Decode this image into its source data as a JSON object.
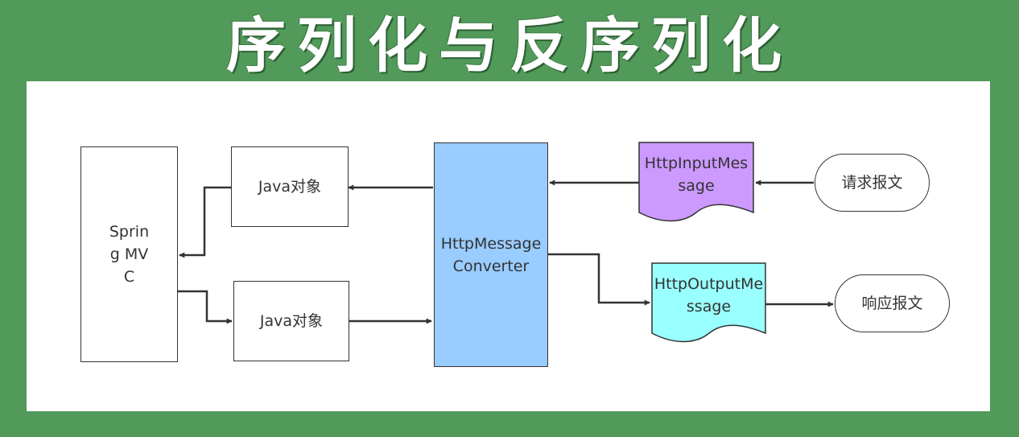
{
  "title": "序列化与反序列化",
  "diagram": {
    "nodes": {
      "spring_mvc": "Spring MVC",
      "java_object_top": "Java对象",
      "java_object_bottom": "Java对象",
      "converter": "HttpMessageConverter",
      "input_message": "HttpInputMessage",
      "output_message": "HttpOutputMessage",
      "request": "请求报文",
      "response": "响应报文"
    },
    "colors": {
      "background": "#519a5a",
      "converter_fill": "#99ccff",
      "input_message_fill": "#cc99ff",
      "output_message_fill": "#99ffff",
      "stroke": "#333333"
    },
    "edges": [
      {
        "from": "request",
        "to": "input_message"
      },
      {
        "from": "input_message",
        "to": "converter"
      },
      {
        "from": "converter",
        "to": "java_object_top"
      },
      {
        "from": "java_object_top",
        "to": "spring_mvc"
      },
      {
        "from": "spring_mvc",
        "to": "java_object_bottom"
      },
      {
        "from": "java_object_bottom",
        "to": "converter"
      },
      {
        "from": "converter",
        "to": "output_message"
      },
      {
        "from": "output_message",
        "to": "response"
      }
    ]
  }
}
